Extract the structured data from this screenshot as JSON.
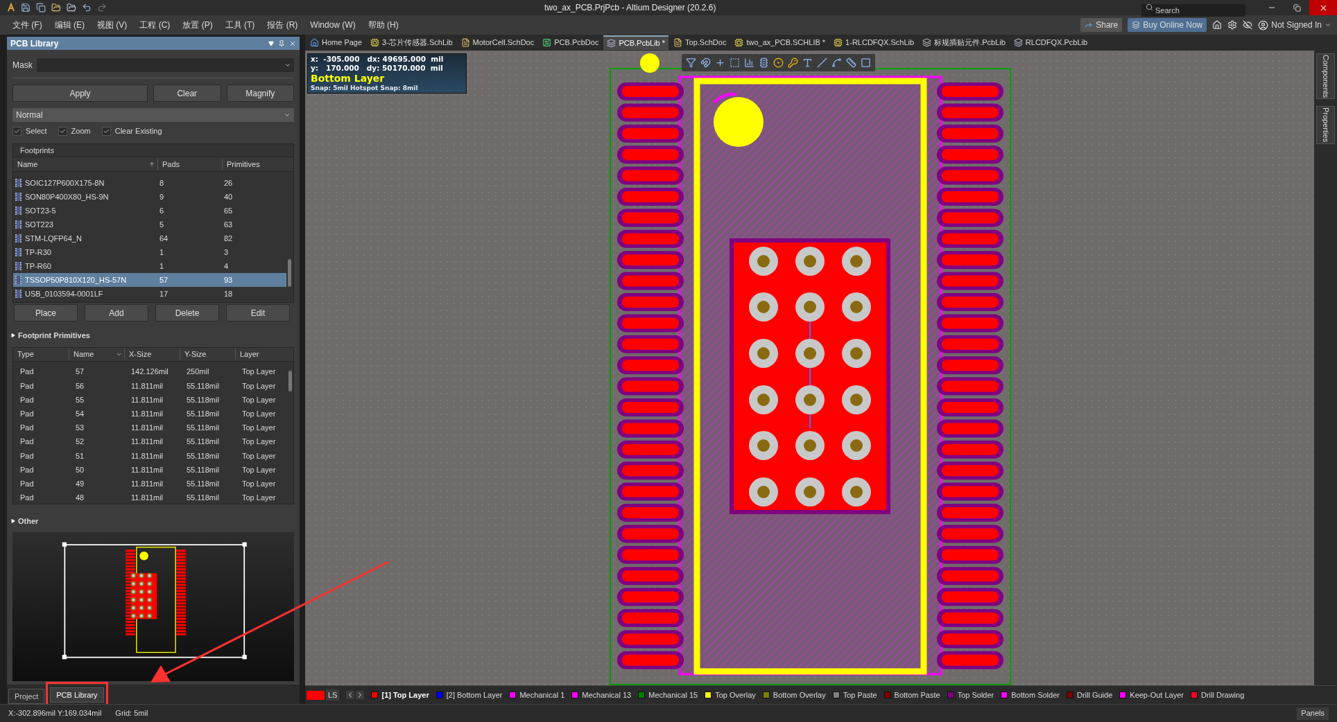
{
  "window": {
    "title": "two_ax_PCB.PrjPcb - Altium Designer (20.2.6)",
    "search": {
      "placeholder": "Search"
    }
  },
  "menu": [
    "文件 (F)",
    "编辑 (E)",
    "视图 (V)",
    "工程 (C)",
    "放置 (P)",
    "工具 (T)",
    "报告 (R)",
    "Window (W)",
    "帮助 (H)"
  ],
  "header": {
    "share": "Share",
    "buy": "Buy Online Now",
    "user": "Not Signed In"
  },
  "panel": {
    "title": "PCB Library",
    "mask_label": "Mask",
    "buttons": [
      "Apply",
      "Clear",
      "Magnify"
    ],
    "mode": "Normal",
    "checkboxes": [
      {
        "label": "Select",
        "checked": true
      },
      {
        "label": "Zoom",
        "checked": true
      },
      {
        "label": "Clear Existing",
        "checked": true
      }
    ],
    "footprints": {
      "title": "Footprints",
      "columns": [
        "Name",
        "Pads",
        "Primitives"
      ],
      "rows": [
        {
          "name": "SOIC127P600X175-8N",
          "pads": "8",
          "primitives": "26",
          "selected": false
        },
        {
          "name": "SON80P400X80_HS-9N",
          "pads": "9",
          "primitives": "40",
          "selected": false
        },
        {
          "name": "SOT23-5",
          "pads": "6",
          "primitives": "65",
          "selected": false
        },
        {
          "name": "SOT223",
          "pads": "5",
          "primitives": "63",
          "selected": false
        },
        {
          "name": "STM-LQFP64_N",
          "pads": "64",
          "primitives": "82",
          "selected": false
        },
        {
          "name": "TP-R30",
          "pads": "1",
          "primitives": "3",
          "selected": false
        },
        {
          "name": "TP-R60",
          "pads": "1",
          "primitives": "4",
          "selected": false
        },
        {
          "name": "TSSOP50P810X120_HS-57N",
          "pads": "57",
          "primitives": "93",
          "selected": true
        },
        {
          "name": "USB_0103594-0001LF",
          "pads": "17",
          "primitives": "18",
          "selected": false
        }
      ]
    },
    "actions": [
      "Place",
      "Add",
      "Delete",
      "Edit"
    ],
    "primitives": {
      "title": "Footprint Primitives",
      "columns": [
        "Type",
        "Name",
        "X-Size",
        "Y-Size",
        "Layer"
      ],
      "rows": [
        {
          "type": "Pad",
          "name": "57",
          "x_size": "142.126mil",
          "y_size": "250mil",
          "layer": "Top Layer"
        },
        {
          "type": "Pad",
          "name": "56",
          "x_size": "11.811mil",
          "y_size": "55.118mil",
          "layer": "Top Layer"
        },
        {
          "type": "Pad",
          "name": "55",
          "x_size": "11.811mil",
          "y_size": "55.118mil",
          "layer": "Top Layer"
        },
        {
          "type": "Pad",
          "name": "54",
          "x_size": "11.811mil",
          "y_size": "55.118mil",
          "layer": "Top Layer"
        },
        {
          "type": "Pad",
          "name": "53",
          "x_size": "11.811mil",
          "y_size": "55.118mil",
          "layer": "Top Layer"
        },
        {
          "type": "Pad",
          "name": "52",
          "x_size": "11.811mil",
          "y_size": "55.118mil",
          "layer": "Top Layer"
        },
        {
          "type": "Pad",
          "name": "51",
          "x_size": "11.811mil",
          "y_size": "55.118mil",
          "layer": "Top Layer"
        },
        {
          "type": "Pad",
          "name": "50",
          "x_size": "11.811mil",
          "y_size": "55.118mil",
          "layer": "Top Layer"
        },
        {
          "type": "Pad",
          "name": "49",
          "x_size": "11.811mil",
          "y_size": "55.118mil",
          "layer": "Top Layer"
        },
        {
          "type": "Pad",
          "name": "48",
          "x_size": "11.811mil",
          "y_size": "55.118mil",
          "layer": "Top Layer"
        }
      ]
    },
    "other_title": "Other",
    "tabs": [
      {
        "label": "Project",
        "selected": false
      },
      {
        "label": "PCB Library",
        "selected": true
      }
    ]
  },
  "doc_tabs": [
    {
      "label": "Home Page",
      "kind": "home",
      "selected": false
    },
    {
      "label": "3-芯片传感器.SchLib",
      "kind": "schlib",
      "selected": false
    },
    {
      "label": "MotorCell.SchDoc",
      "kind": "schdoc",
      "selected": false
    },
    {
      "label": "PCB.PcbDoc",
      "kind": "pcbdoc",
      "selected": false
    },
    {
      "label": "PCB.PcbLib *",
      "kind": "pcblib",
      "selected": true
    },
    {
      "label": "Top.SchDoc",
      "kind": "schdoc",
      "selected": false
    },
    {
      "label": "two_ax_PCB.SCHLIB *",
      "kind": "schlib",
      "selected": false
    },
    {
      "label": "1-RLCDFQX.SchLib",
      "kind": "schlib",
      "selected": false
    },
    {
      "label": "标规插贴元件.PcbLib",
      "kind": "pcblib",
      "selected": false
    },
    {
      "label": "RLCDFQX.PcbLib",
      "kind": "pcblib",
      "selected": false
    }
  ],
  "coords": {
    "x_line": "x:  -305.000   dx: 49695.000  mil",
    "y_line": "y:   170.000   dy: 50170.000  mil",
    "layer": "Bottom Layer",
    "snap": "Snap: 5mil Hotspot Snap: 8mil"
  },
  "side_tabs": [
    "Components",
    "Properties"
  ],
  "layer_bar": {
    "ls": "LS",
    "layers": [
      {
        "label": "[1] Top Layer",
        "color": "#ff0000",
        "selected": true
      },
      {
        "label": "[2] Bottom Layer",
        "color": "#0000ff",
        "selected": false
      },
      {
        "label": "Mechanical 1",
        "color": "#ff00ff",
        "selected": false
      },
      {
        "label": "Mechanical 13",
        "color": "#ff00ff",
        "selected": false
      },
      {
        "label": "Mechanical 15",
        "color": "#008000",
        "selected": false
      },
      {
        "label": "Top Overlay",
        "color": "#ffff00",
        "selected": false
      },
      {
        "label": "Bottom Overlay",
        "color": "#808000",
        "selected": false
      },
      {
        "label": "Top Paste",
        "color": "#808080",
        "selected": false
      },
      {
        "label": "Bottom Paste",
        "color": "#800000",
        "selected": false
      },
      {
        "label": "Top Solder",
        "color": "#800080",
        "selected": false
      },
      {
        "label": "Bottom Solder",
        "color": "#ff00ff",
        "selected": false
      },
      {
        "label": "Drill Guide",
        "color": "#800000",
        "selected": false
      },
      {
        "label": "Keep-Out Layer",
        "color": "#ff00ff",
        "selected": false
      },
      {
        "label": "Drill Drawing",
        "color": "#ff002a",
        "selected": false
      }
    ]
  },
  "status_bar": {
    "position": "X:-302.896mil Y:169.034mil",
    "grid": "Grid: 5mil",
    "panels": "Panels"
  }
}
